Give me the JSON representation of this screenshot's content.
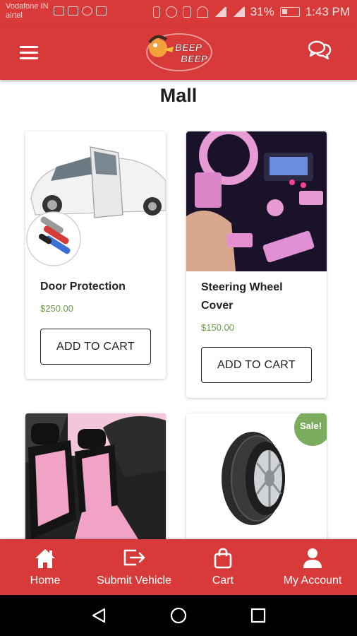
{
  "status_bar": {
    "carrier_line1": "Vodafone IN",
    "carrier_line2": "airtel",
    "battery": "31%",
    "time": "1:43 PM"
  },
  "header": {
    "logo_text_line1": "BEEP",
    "logo_text_line2": "BEEP"
  },
  "page": {
    "title": "Mall"
  },
  "products": [
    {
      "name": "Door Protection",
      "price": "$250.00",
      "button": "ADD TO CART"
    },
    {
      "name_line1": "Steering Wheel",
      "name_line2": "Cover",
      "price": "$150.00",
      "button": "ADD TO CART"
    },
    {
      "name": "",
      "price": ""
    },
    {
      "badge": "Sale!"
    }
  ],
  "bottom_nav": [
    {
      "label": "Home",
      "icon": "home-icon"
    },
    {
      "label": "Submit Vehicle",
      "icon": "exit-arrow-icon"
    },
    {
      "label": "Cart",
      "icon": "shopping-bag-icon"
    },
    {
      "label": "My Account",
      "icon": "user-icon"
    }
  ],
  "colors": {
    "primary_red": "#d83a3a",
    "price_green": "#6a9a48",
    "sale_green": "#7cad5e"
  }
}
